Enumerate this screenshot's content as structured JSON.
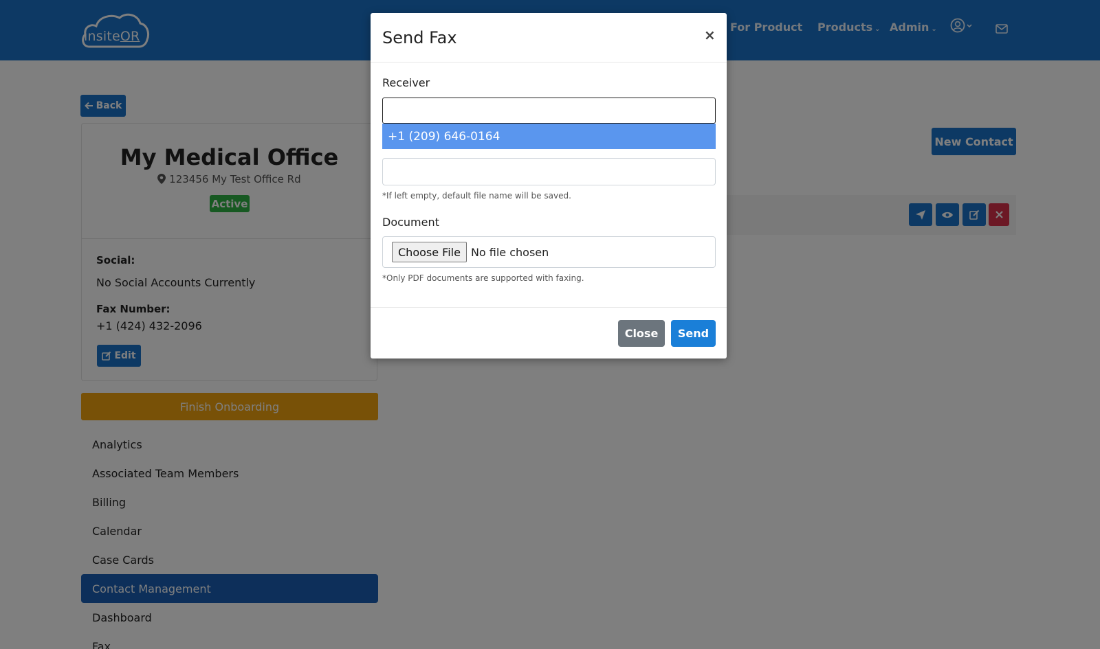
{
  "app": {
    "logo_text_a": "insite",
    "logo_text_b": "OR"
  },
  "nav": {
    "search_partial": "h For Product",
    "products": "Products",
    "admin": "Admin"
  },
  "back_label": "Back",
  "office": {
    "name": "My Medical Office",
    "address": "123456 My Test Office Rd",
    "status": "Active",
    "social_label": "Social:",
    "social_value": "No Social Accounts Currently",
    "fax_label": "Fax Number:",
    "fax_value": "+1 (424) 432-2096",
    "edit_label": "Edit"
  },
  "onboarding_label": "Finish Onboarding",
  "sidebar": {
    "items": [
      {
        "label": "Analytics",
        "active": false
      },
      {
        "label": "Associated Team Members",
        "active": false
      },
      {
        "label": "Billing",
        "active": false
      },
      {
        "label": "Calendar",
        "active": false
      },
      {
        "label": "Case Cards",
        "active": false
      },
      {
        "label": "Contact Management",
        "active": true
      },
      {
        "label": "Dashboard",
        "active": false
      },
      {
        "label": "Fax",
        "active": false
      }
    ]
  },
  "main": {
    "new_contact_label": "New Contact"
  },
  "modal": {
    "title": "Send Fax",
    "close_glyph": "×",
    "receiver_label": "Receiver",
    "receiver_value": "",
    "suggestion": "+1 (209) 646-0164",
    "filename_value": "",
    "filename_hint": "*If left empty, default file name will be saved.",
    "document_label": "Document",
    "choose_file_label": "Choose File",
    "no_file_text": "No file chosen",
    "document_hint": "*Only PDF documents are supported with faxing.",
    "close_button": "Close",
    "send_button": "Send"
  },
  "colors": {
    "brand": "#1a73c9",
    "active_badge": "#2fb344",
    "onboarding": "#f0a30f",
    "sidebar_active": "#1a5fb4",
    "danger": "#d9304a",
    "suggestion_highlight": "#5a96ee"
  },
  "icons": [
    "cloud-logo-icon",
    "chevron-down-icon",
    "user-circle-icon",
    "envelope-icon",
    "arrow-left-icon",
    "map-pin-icon",
    "edit-icon",
    "send-icon",
    "eye-icon",
    "close-icon"
  ]
}
